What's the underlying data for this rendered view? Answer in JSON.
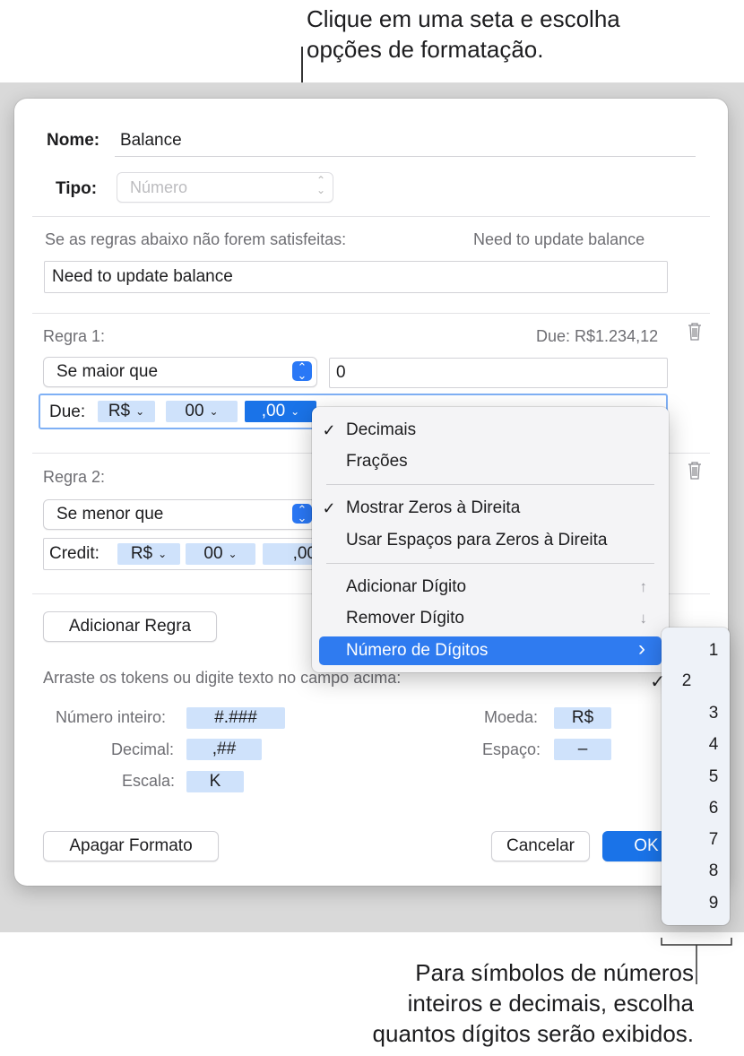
{
  "callouts": {
    "top": [
      "Clique em uma seta e escolha",
      "opções de formatação."
    ],
    "bottom": [
      "Para símbolos de números",
      "inteiros e decimais, escolha",
      "quantos dígitos serão exibidos."
    ]
  },
  "form": {
    "name_label": "Nome:",
    "name_value": "Balance",
    "type_label": "Tipo:",
    "type_value": "Número"
  },
  "fallback": {
    "label": "Se as regras abaixo não forem satisfeitas:",
    "preview": "Need to update balance",
    "value": "Need to update balance"
  },
  "rules": [
    {
      "label": "Regra 1:",
      "preview": "Due: R$1.234,12",
      "condition": "Se maior que",
      "value": "0",
      "prefix": "Due:",
      "tokens": [
        "R$",
        "00",
        ",00"
      ]
    },
    {
      "label": "Regra 2:",
      "condition": "Se menor que",
      "prefix": "Credit:",
      "tokens": [
        "R$",
        "00",
        ",00"
      ]
    }
  ],
  "add_rule": "Adicionar Regra",
  "tokens_hint": "Arraste os tokens ou digite texto no campo acima:",
  "token_palette": {
    "integer_label": "Número inteiro:",
    "integer_token": "#.###",
    "decimal_label": "Decimal:",
    "decimal_token": ",##",
    "scale_label": "Escala:",
    "scale_token": "K",
    "currency_label": "Moeda:",
    "currency_token": "R$",
    "space_label": "Espaço:",
    "space_token": "–"
  },
  "buttons": {
    "delete_format": "Apagar Formato",
    "cancel": "Cancelar",
    "ok": "OK"
  },
  "menu": {
    "decimals": "Decimais",
    "fractions": "Frações",
    "show_zeros": "Mostrar Zeros à Direita",
    "use_spaces": "Usar Espaços para Zeros à Direita",
    "add_digit": "Adicionar Dígito",
    "add_digit_shortcut": "↑",
    "remove_digit": "Remover Dígito",
    "remove_digit_shortcut": "↓",
    "num_digits": "Número de Dígitos",
    "check": "✓",
    "arrow": "›"
  },
  "digits": [
    "1",
    "2",
    "3",
    "4",
    "5",
    "6",
    "7",
    "8",
    "9"
  ],
  "selected_digit": "2"
}
